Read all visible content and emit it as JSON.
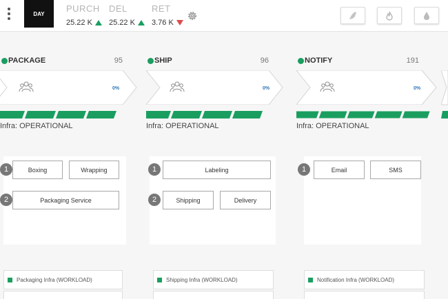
{
  "toolbar": {
    "period_label": "DAY",
    "metrics": [
      {
        "label": "PURCH",
        "value": "25.22 K",
        "trend": "up"
      },
      {
        "label": "DEL",
        "value": "25.22 K",
        "trend": "up"
      },
      {
        "label": "RET",
        "value": "3.76 K",
        "trend": "down"
      }
    ],
    "tool_icons": [
      "bird-icon",
      "flame-icon",
      "drop-icon"
    ]
  },
  "colors": {
    "accent": "#1a9e60",
    "down": "#dd4b4b",
    "dark": "#111111"
  },
  "stages": [
    {
      "name": "PACKAGE",
      "count": "95",
      "percent": "0%",
      "infra": "Infra: OPERATIONAL",
      "workload": "Packaging Infra (WORKLOAD)",
      "tasks": [
        {
          "step": "1",
          "buttons": [
            "Boxing",
            "Wrapping"
          ]
        },
        {
          "step": "2",
          "buttons": [
            "Packaging Service"
          ]
        }
      ]
    },
    {
      "name": "SHIP",
      "count": "96",
      "percent": "0%",
      "infra": "Infra: OPERATIONAL",
      "workload": "Shipping Infra (WORKLOAD)",
      "tasks": [
        {
          "step": "1",
          "buttons": [
            "Labeling"
          ]
        },
        {
          "step": "2",
          "buttons": [
            "Shipping",
            "Delivery"
          ]
        }
      ]
    },
    {
      "name": "NOTIFY",
      "count": "191",
      "percent": "0%",
      "infra": "Infra: OPERATIONAL",
      "workload": "Notification Infra (WORKLOAD)",
      "tasks": [
        {
          "step": "1",
          "buttons": [
            "Email",
            "SMS"
          ]
        }
      ]
    }
  ]
}
